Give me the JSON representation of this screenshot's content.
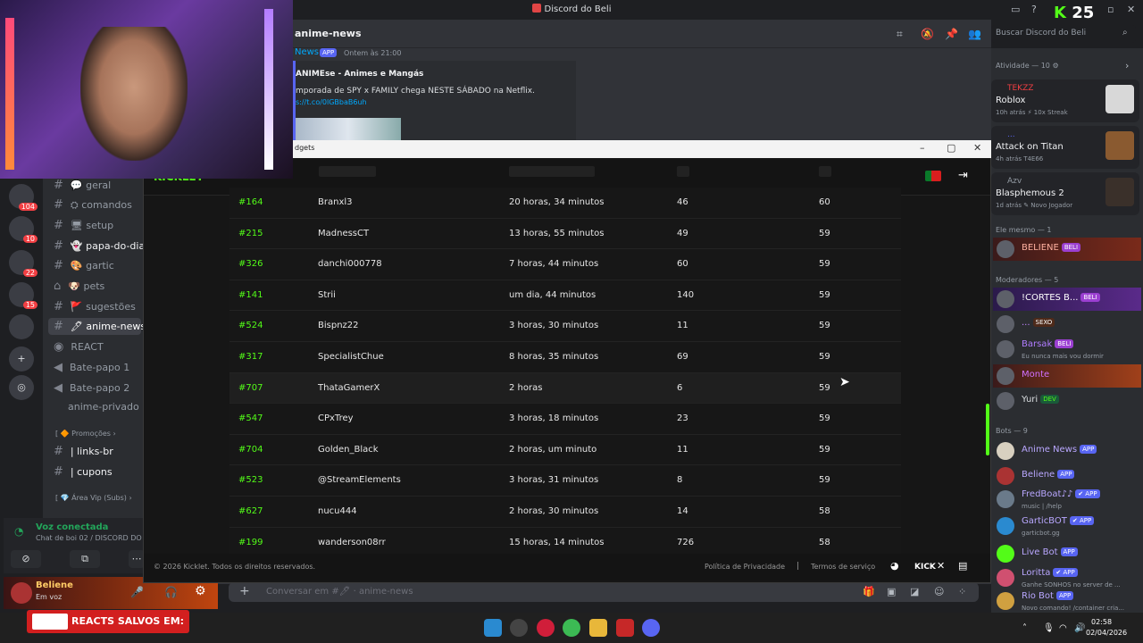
{
  "app": {
    "title": "Discord do Beli"
  },
  "kick_badge": {
    "logo": "K",
    "count": "25"
  },
  "channels": {
    "items": [
      {
        "label": "geral",
        "emoji": "💬"
      },
      {
        "label": "comandos",
        "emoji": "⛭"
      },
      {
        "label": "setup",
        "emoji": "🖥"
      },
      {
        "label": "papa-do-dia",
        "emoji": "👻"
      },
      {
        "label": "gartic",
        "emoji": "🎨"
      },
      {
        "label": "pets",
        "emoji": "🐶"
      },
      {
        "label": "sugestões",
        "emoji": "🚩"
      },
      {
        "label": "anime-news",
        "emoji": "🖊"
      }
    ],
    "react": "REACT",
    "voice": [
      "Bate-papo 1",
      "Bate-papo 2"
    ],
    "private": "anime-privado",
    "cat_promo": "Promoções",
    "promo_items": [
      "| links-br",
      "| cupons"
    ],
    "cat_vip": "Área Vip (Subs)"
  },
  "voice_panel": {
    "title": "Voz conectada",
    "subtitle": "Chat de boi 02 / DISCORD DO"
  },
  "user": {
    "name": "Beliene",
    "status": "Em voz"
  },
  "server_badges": [
    "104",
    "10",
    "22",
    "15"
  ],
  "chat": {
    "channel": "anime-news",
    "search_placeholder": "Buscar Discord do Beli",
    "author": "News",
    "app_tag": "APP",
    "time": "Ontem às 21:00",
    "embed_title": "ANIMEse - Animes e Mangás",
    "embed_text": "mporada de SPY x FAMILY chega NESTE SÁBADO na Netflix.",
    "embed_link": "s://t.co/0lGBbaB6uh",
    "input_placeholder": "Conversar em #",
    "input_channel": "anime-news"
  },
  "kicklet": {
    "window_title": "dgets",
    "logo": "KICKLET",
    "rows": [
      {
        "rank": "#164",
        "name": "Branxl3",
        "time": "20 horas, 34 minutos",
        "msgs": "46",
        "points": "60"
      },
      {
        "rank": "#215",
        "name": "MadnessCT",
        "time": "13 horas, 55 minutos",
        "msgs": "49",
        "points": "59"
      },
      {
        "rank": "#326",
        "name": "danchi000778",
        "time": "7 horas, 44 minutos",
        "msgs": "60",
        "points": "59"
      },
      {
        "rank": "#141",
        "name": "Strii",
        "time": "um dia, 44 minutos",
        "msgs": "140",
        "points": "59"
      },
      {
        "rank": "#524",
        "name": "Bispnz22",
        "time": "3 horas, 30 minutos",
        "msgs": "11",
        "points": "59"
      },
      {
        "rank": "#317",
        "name": "SpecialistChue",
        "time": "8 horas, 35 minutos",
        "msgs": "69",
        "points": "59"
      },
      {
        "rank": "#707",
        "name": "ThataGamerX",
        "time": "2 horas",
        "msgs": "6",
        "points": "59"
      },
      {
        "rank": "#547",
        "name": "CPxTrey",
        "time": "3 horas, 18 minutos",
        "msgs": "23",
        "points": "59"
      },
      {
        "rank": "#704",
        "name": "Golden_Black",
        "time": "2 horas, um minuto",
        "msgs": "11",
        "points": "59"
      },
      {
        "rank": "#523",
        "name": "@StreamElements",
        "time": "3 horas, 31 minutos",
        "msgs": "8",
        "points": "59"
      },
      {
        "rank": "#627",
        "name": "nucu444",
        "time": "2 horas, 30 minutos",
        "msgs": "14",
        "points": "58"
      },
      {
        "rank": "#199",
        "name": "wanderson08rr",
        "time": "15 horas, 14 minutos",
        "msgs": "726",
        "points": "58"
      }
    ],
    "footer": {
      "copyright": "© 2026 Kicklet. Todos os direitos reservados.",
      "privacy": "Política de Privacidade",
      "separator": "|",
      "terms": "Termos de serviço",
      "kick": "KICK"
    }
  },
  "members": {
    "activity_header": "Atividade — 10",
    "activities": [
      {
        "name": "TEKZZ",
        "game": "Roblox",
        "meta": "10h atrás  ⚡ 10x Streak",
        "color": "#f23f43"
      },
      {
        "name": "...",
        "game": "Attack on Titan",
        "meta": "4h atrás  T4E66",
        "color": "#5865f2"
      },
      {
        "name": "Azv",
        "game": "Blasphemous 2",
        "meta": "1d atrás  ✎ Novo Jogador",
        "color": "#949ba4"
      }
    ],
    "same_header": "Ele mesmo — 1",
    "self": {
      "name": "BELIENE",
      "tag": "BELI"
    },
    "mods_header": "Moderadores — 5",
    "mods": [
      {
        "name": "!CORTES B...",
        "tag": "BELI",
        "sub": ""
      },
      {
        "name": "...",
        "tag": "SEXO",
        "sub": ""
      },
      {
        "name": "Barsak",
        "tag": "BELI",
        "sub": "Eu nunca mais vou dormir"
      },
      {
        "name": "Monte",
        "tag": "",
        "sub": ""
      },
      {
        "name": "Yuri",
        "tag": "DEV",
        "sub": ""
      }
    ],
    "bots_header": "Bots — 9",
    "bots": [
      {
        "name": "Anime News",
        "tag": "APP",
        "sub": ""
      },
      {
        "name": "Beliene",
        "tag": "APP",
        "sub": ""
      },
      {
        "name": "FredBoat♪♪",
        "tag": "✔ APP",
        "sub": "music | /help"
      },
      {
        "name": "GarticBOT",
        "tag": "✔ APP",
        "sub": "garticbot.gg"
      },
      {
        "name": "Live Bot",
        "tag": "APP",
        "sub": ""
      },
      {
        "name": "Loritta",
        "tag": "✔ APP",
        "sub": "Ganhe SONHOS no server de ..."
      },
      {
        "name": "Rio Bot",
        "tag": "APP",
        "sub": "Novo comando! /container cria..."
      }
    ]
  },
  "overlay": {
    "reacts": "REACTS SALVOS EM:"
  },
  "taskbar": {
    "time": "02:58",
    "date": "02/04/2026"
  }
}
